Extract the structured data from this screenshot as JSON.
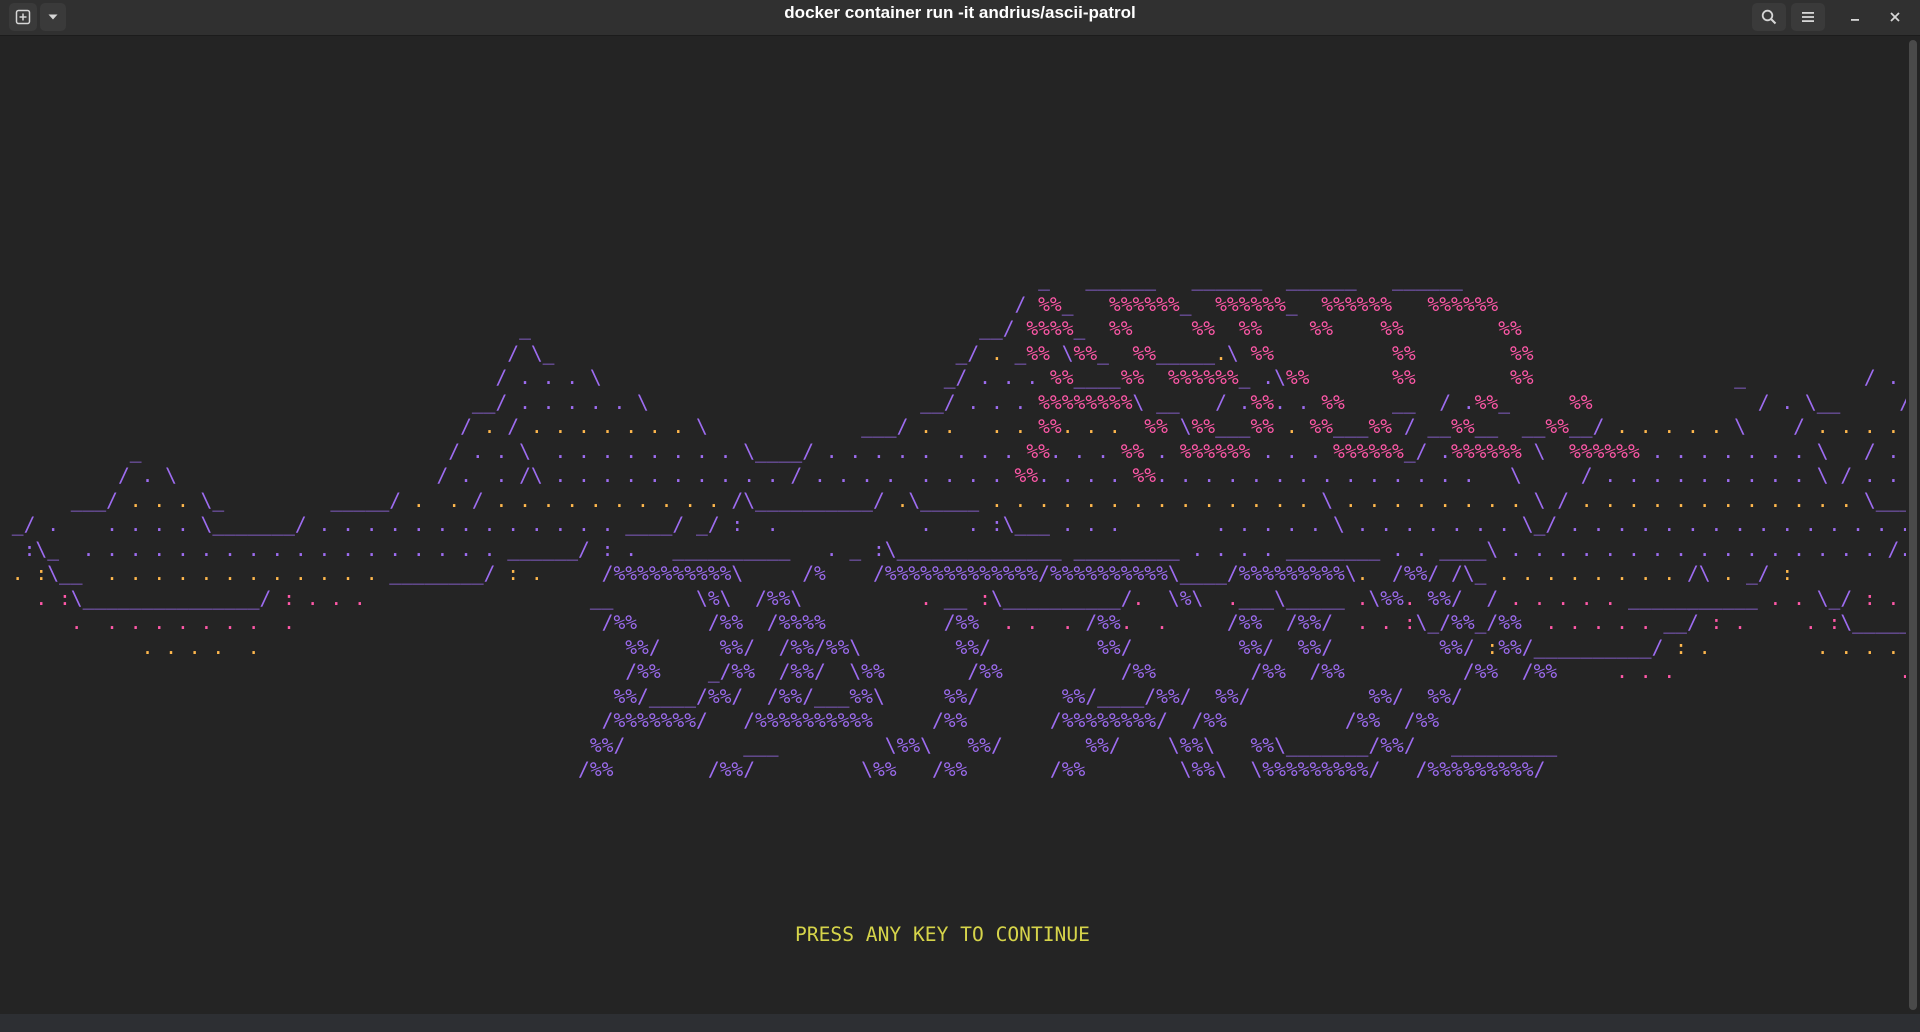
{
  "window": {
    "title": "docker container run -it andrius/ascii-patrol"
  },
  "terminal": {
    "logo_lines": [
      "                                                                                        _   ______   ______  ______   ______",
      "                                                                                      / %%_   %%%%%%_  %%%%%%_  %%%%%%   %%%%%%",
      "                                            _                                      __/ %%%%_  %%     %%  %%    %%    %%        %%",
      "                                           / \\_                                  _/ . _%% \\%%_  %%_____.\\ %%          %%        %%                                _                               _",
      "                                          / . . . \\                             _/ . . . %%____%%  %%%%%%_ .\\%%       %%        %%                 _          / . \\__                        / \\__",
      "                                        __/ . . . . . \\                       __/ . . . %%%%%%%%\\ __   / .%%. . %%    __  / .%%_     %%              / . \\__     / . . . . \\                     / . . . . \\",
      "                                       / . / . . . . . . . \\             ___/ . .   . . %%. . .  %% \\%%___%% . %%___%% / __%%__  __%%__/ . . . . . \\    / . . . . . . . \\                  /\\",
      "           _                          / . . \\  . . . . . . . . \\____/ . . . . .  . . . %%. . . %% . %%%%%% . . . %%%%%%_/ .%%%%%% \\  %%%%%% . . . . . . . \\   / . . . . . . . . \\___     _          / . \\",
      "          / . \\                      / .  . /\\ . . . . . . . . . . / . . . .  . . . . %%. . . . %%. . . . . . . . . . . . . .   \\     / . . . . . . . . . \\ / . . . . . . . . . . . \\  / . \\       / . . . \\",
      "      ___/ . . . \\_         _____/ .  . / . . . . . . . . . . /\\__________/ .\\_____ . . . . . . . . . . . . . . \\ . . . . . . . . \\ / . . . . . . . . . . . . \\____/ . . . \\   ___/ . . . . . \\",
      " _/ .    . . . . \\_______/ . . . . . . . . . . . . . ____/ _/ :  .            .   . :\\___ . . .        . . . . . \\ . . . . . . . \\_/ . . . . . . . . . . . . . . . \\____/ . . .  . \\_____",
      "  :\\_  . . . . . . . . . . . . . . . . . . ______/ : .   __________   . _ :\\______________ _________ . . . . ________ . . ____\\ . . . . . . . . . . . . . . . . /. . . . . _/ :",
      " . :\\__  . . . . . . . . . . . . ________/ : .     /%%%%%%%%%%\\     /%    /%%%%%%%%%%%%%/%%%%%%%%%%\\____/%%%%%%%%%\\.  /%%/ /\\_ . . . . . . . . /\\ . _/ :",
      "   . :\\_______________/ : . . .                   __       \\%\\  /%%\\          . __ :\\__________/.  \\%\\  .___\\_____ .\\%%. %%/  / . . . . . ___________ . . \\_/ : .",
      "      .  . . . . . . .  .                          /%%      /%%  /%%%%          /%%  . .  . /%%.  .     /%%  /%%/  . . :\\_/%%_/%%  . . . . . __/ : .     . :\\________/ : .",
      "            . . . .  .                               %%/     %%/  /%%/%%\\        %%/         %%/         %%/  %%/         %%/ :%%/__________/ : .         . . . . . . .",
      "                                                     /%%    _/%%  /%%/  \\%%       /%%          /%%        /%%  /%%          /%%  /%%     . . .                   . . .",
      "                                                    %%/____/%%/  /%%/___%%\\     %%/       %%/____/%%/  %%/          %%/  %%/",
      "                                                   /%%%%%%%/   /%%%%%%%%%%     /%%       /%%%%%%%%/  /%%          /%%  /%%",
      "                                                  %%/          ___         \\%%\\   %%/       %%/    \\%%\\   %%\\_______/%%/   _________",
      "                                                 /%%        /%%/         \\%%   /%%       /%%        \\%%\\  \\%%%%%%%%%/   /%%%%%%%%%/"
    ],
    "prompt": "PRESS ANY KEY TO CONTINUE"
  },
  "colors": {
    "background": "#242424",
    "titlebar": "#303030",
    "logo_pink": "#ff58a8",
    "logo_orange": "#ffb84d",
    "logo_purple": "#9d6cf0",
    "prompt_yellow": "#d6d44a"
  },
  "icons": {
    "new_tab": "plus-in-square-icon",
    "tab_menu": "chevron-down-icon",
    "search": "search-icon",
    "menu": "hamburger-icon",
    "minimize": "minimize-icon",
    "close": "close-icon"
  }
}
